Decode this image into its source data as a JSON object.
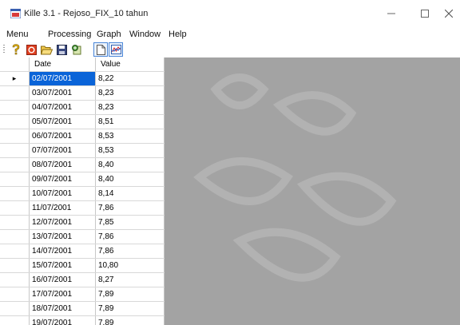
{
  "window": {
    "title": "Kille 3.1 - Rejoso_FIX_10 tahun",
    "icons": {
      "app": "app-icon",
      "minimize": "minimize-icon",
      "maximize": "maximize-icon",
      "close": "close-icon"
    }
  },
  "menu": [
    "Menu",
    "Processing",
    "Graph",
    "Window",
    "Help"
  ],
  "toolbar": [
    {
      "name": "help-icon"
    },
    {
      "name": "stop-icon"
    },
    {
      "name": "open-folder-icon"
    },
    {
      "name": "save-icon"
    },
    {
      "name": "export-icon"
    },
    {
      "name": "new-document-icon"
    },
    {
      "name": "graph-icon"
    }
  ],
  "grid": {
    "columns": [
      "Date",
      "Value"
    ],
    "selected_row": 0,
    "row_marker": "▸",
    "rows": [
      [
        "02/07/2001",
        "8,22"
      ],
      [
        "03/07/2001",
        "8,23"
      ],
      [
        "04/07/2001",
        "8,23"
      ],
      [
        "05/07/2001",
        "8,51"
      ],
      [
        "06/07/2001",
        "8,53"
      ],
      [
        "07/07/2001",
        "8,53"
      ],
      [
        "08/07/2001",
        "8,40"
      ],
      [
        "09/07/2001",
        "8,40"
      ],
      [
        "10/07/2001",
        "8,14"
      ],
      [
        "11/07/2001",
        "7,86"
      ],
      [
        "12/07/2001",
        "7,85"
      ],
      [
        "13/07/2001",
        "7,86"
      ],
      [
        "14/07/2001",
        "7,86"
      ],
      [
        "15/07/2001",
        "10,80"
      ],
      [
        "16/07/2001",
        "8,27"
      ],
      [
        "17/07/2001",
        "7,89"
      ],
      [
        "18/07/2001",
        "7,89"
      ],
      [
        "19/07/2001",
        "7,89"
      ]
    ]
  },
  "colors": {
    "selection": "#0a64d8",
    "workspace": "#a3a3a3",
    "close_icon": "#555555"
  }
}
